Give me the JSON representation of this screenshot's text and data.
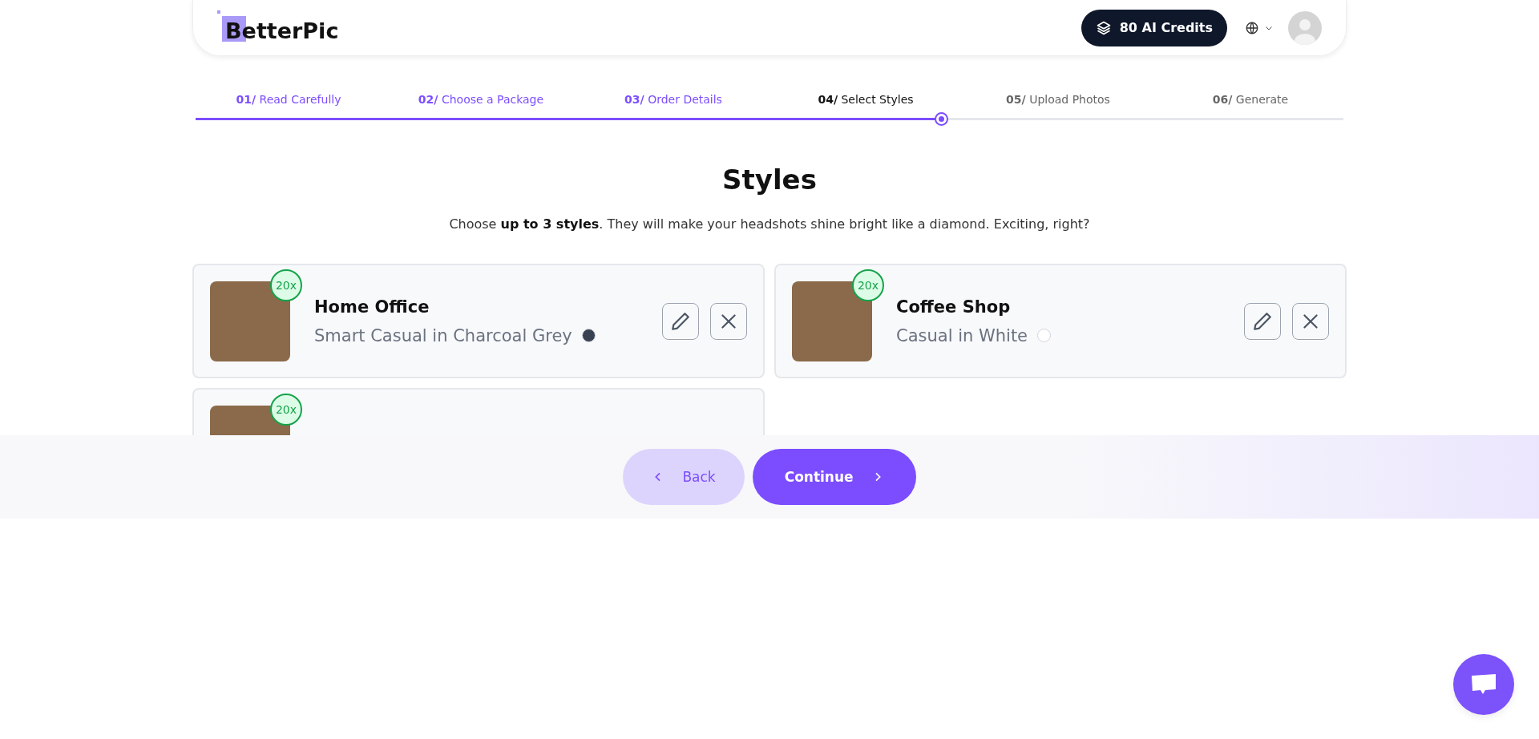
{
  "header": {
    "logo": "BetterPic",
    "credits": "80 AI Credits"
  },
  "steps": [
    {
      "number": "01/",
      "label": "Read Carefully",
      "completed": true,
      "selected": false
    },
    {
      "number": "02/",
      "label": "Choose a Package",
      "completed": true,
      "selected": false
    },
    {
      "number": "03/",
      "label": "Order Details",
      "completed": true,
      "selected": false
    },
    {
      "number": "04/",
      "label": "Select Styles",
      "completed": false,
      "selected": true
    },
    {
      "number": "05/",
      "label": "Upload Photos",
      "completed": false,
      "selected": false
    },
    {
      "number": "06/",
      "label": "Generate",
      "completed": false,
      "selected": false
    }
  ],
  "progress": {
    "level": 0.65
  },
  "title": "Styles",
  "subtitle": "Choose **up to 3 styles**. They will make your headshots shine bright like a diamond. Exciting, right?",
  "styles": [
    {
      "name": "Home Office",
      "outfit": "Smart Casual in Charcoal Grey",
      "color": "#374151",
      "count": "20x"
    },
    {
      "name": "Coffee Shop",
      "outfit": "Casual in White",
      "color": "#ffffff",
      "count": "20x"
    },
    {
      "count": "20x"
    }
  ],
  "footer": {
    "back": "Back",
    "continue": "Continue"
  }
}
